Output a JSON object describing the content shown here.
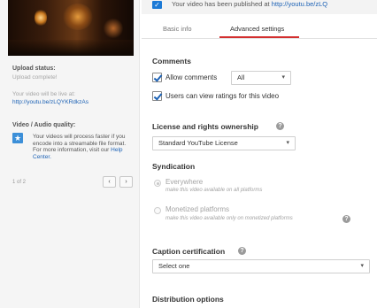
{
  "banner": {
    "message": "Your video has been published at",
    "url": "http://youtu.be/zLQ"
  },
  "tabs": [
    {
      "label": "Basic info"
    },
    {
      "label": "Advanced settings"
    }
  ],
  "sidebar": {
    "upload_status_label": "Upload status:",
    "upload_status_value": "Upload complete!",
    "live_text": "Your video will be live at:",
    "live_url": "http://youtu.be/zLQYKRdkzAs",
    "quality_label": "Video / Audio quality:",
    "quality_text": "Your videos will process faster if you encode into a streamable file format. For more information, visit our",
    "help_center": "Help Center.",
    "pager_text": "1 of 2",
    "prev_glyph": "‹",
    "next_glyph": "›"
  },
  "comments": {
    "heading": "Comments",
    "allow_label": "Allow comments",
    "allow_select": "All",
    "ratings_label": "Users can view ratings for this video"
  },
  "license": {
    "heading": "License and rights ownership",
    "select_value": "Standard YouTube License"
  },
  "syndication": {
    "heading": "Syndication",
    "option1_label": "Everywhere",
    "option1_sub": "make this video available on all platforms",
    "option2_label": "Monetized platforms",
    "option2_sub": "make this video available only on monetized platforms"
  },
  "caption": {
    "heading": "Caption certification",
    "select_value": "Select one"
  },
  "distribution": {
    "heading": "Distribution options"
  },
  "icons": {
    "help": "?",
    "check": "✓",
    "info": "★",
    "dropdown": "▾"
  },
  "colors": {
    "accent_red": "#d32f2f",
    "link_blue": "#1d62b5",
    "check_blue": "#1d7ad6"
  }
}
